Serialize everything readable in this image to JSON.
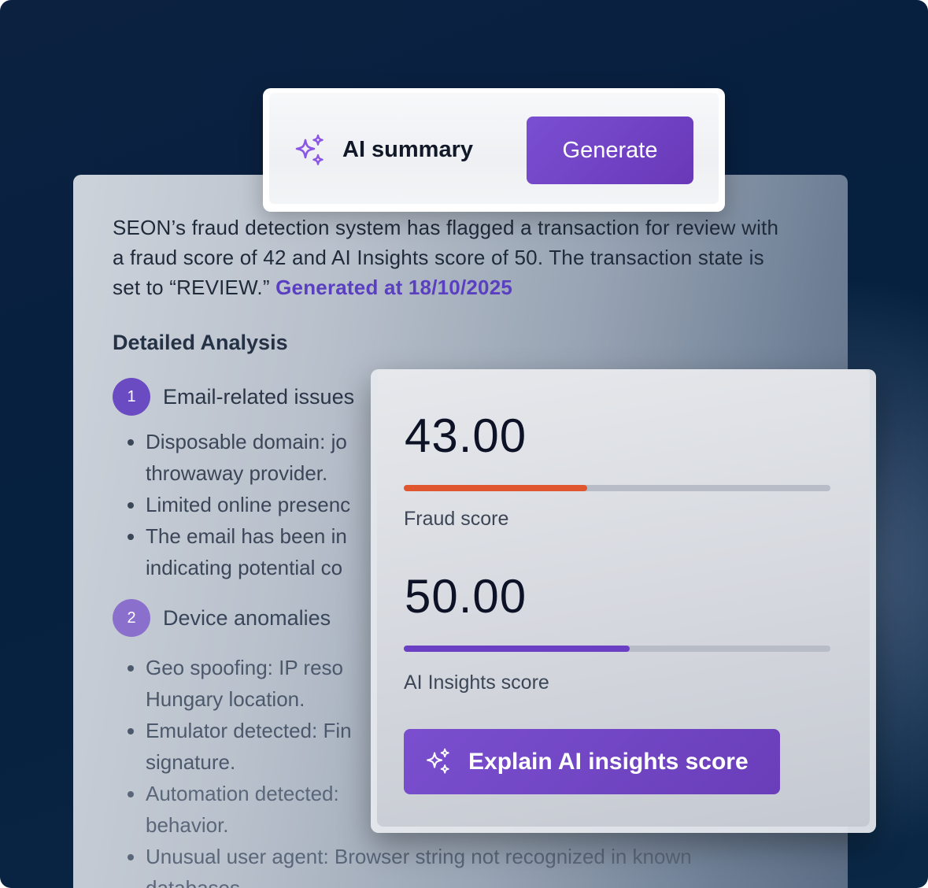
{
  "ai_summary": {
    "title": "AI summary",
    "generate_label": "Generate",
    "icon": "sparkles-icon"
  },
  "analysis": {
    "summary_text": "SEON’s fraud detection system has flagged a transaction for review with a fraud score of 42 and AI Insights score of 50. The transaction state is set to “REVIEW.”",
    "generated_at": "Generated at 18/10/2025",
    "heading": "Detailed Analysis",
    "sections": [
      {
        "number": "1",
        "title": "Email-related issues",
        "bullets": [
          "Disposable domain: jo",
          "throwaway provider.",
          "Limited online presenc",
          "The email has been in",
          "indicating potential co"
        ]
      },
      {
        "number": "2",
        "title": "Device anomalies",
        "bullets": [
          "Geo spoofing: IP reso",
          "Hungary location.",
          "Emulator detected: Fin",
          "signature.",
          "Automation detected:",
          "behavior.",
          "Unusual user agent: Browser string not recognized in known",
          "databases."
        ]
      }
    ]
  },
  "scores": {
    "fraud": {
      "value": "43.00",
      "label": "Fraud score",
      "fraction": 0.43,
      "color": "#e0572f"
    },
    "ai_insights": {
      "value": "50.00",
      "label": "AI Insights score",
      "fraction": 0.53,
      "color": "#6a3fc4"
    },
    "explain_label": "Explain AI insights score"
  },
  "colors": {
    "accent_purple": "#6a3fc4",
    "fraud_orange": "#e0572f",
    "background_navy": "#06203f"
  }
}
